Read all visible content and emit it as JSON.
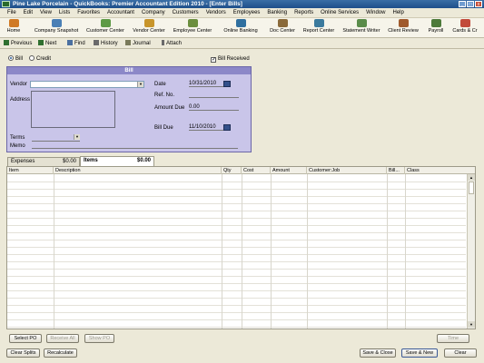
{
  "window": {
    "title": "Pine Lake Porcelain  - QuickBooks: Premier Accountant Edition 2010 - [Enter Bills]",
    "min": "_",
    "max": "□",
    "close": "x"
  },
  "menu": [
    "File",
    "Edit",
    "View",
    "Lists",
    "Favorites",
    "Accountant",
    "Company",
    "Customers",
    "Vendors",
    "Employees",
    "Banking",
    "Reports",
    "Online Services",
    "Window",
    "Help"
  ],
  "iconbar": [
    {
      "label": "Home",
      "icon": "home-icon",
      "color": "#d07a25"
    },
    {
      "label": "Company Snapshot",
      "icon": "snapshot-icon",
      "color": "#4a7fb5"
    },
    {
      "label": "Customer Center",
      "icon": "customer-icon",
      "color": "#5e9a45"
    },
    {
      "label": "Vendor Center",
      "icon": "vendor-icon",
      "color": "#c8952b"
    },
    {
      "label": "Employee Center",
      "icon": "employee-icon",
      "color": "#6b8e3e"
    },
    {
      "label": "Online Banking",
      "icon": "banking-icon",
      "color": "#2f6f9f"
    },
    {
      "label": "Doc Center",
      "icon": "doc-icon",
      "color": "#8a6a3a"
    },
    {
      "label": "Report Center",
      "icon": "report-icon",
      "color": "#3b7a9d"
    },
    {
      "label": "Statement Writer",
      "icon": "statement-icon",
      "color": "#5a8c4a"
    },
    {
      "label": "Client Review",
      "icon": "review-icon",
      "color": "#a05a2c"
    },
    {
      "label": "Payroll",
      "icon": "payroll-icon",
      "color": "#4d7a3a"
    },
    {
      "label": "Cards & Cr",
      "icon": "cards-icon",
      "color": "#c24a3a"
    }
  ],
  "formbar": {
    "previous": "Previous",
    "next": "Next",
    "find": "Find",
    "history": "History",
    "journal": "Journal",
    "attach": "Attach"
  },
  "options": {
    "bill": "Bill",
    "credit": "Credit",
    "bill_received": "Bill Received",
    "bill_received_checked": "✓"
  },
  "bill": {
    "header": "Bill",
    "vendor_label": "Vendor",
    "vendor_value": "",
    "address_label": "Address",
    "terms_label": "Terms",
    "memo_label": "Memo",
    "date_label": "Date",
    "date_value": "10/31/2010",
    "refno_label": "Ref. No.",
    "amount_due_label": "Amount Due",
    "amount_due_value": "0.00",
    "bill_due_label": "Bill Due",
    "bill_due_value": "11/10/2010"
  },
  "tabs": {
    "expenses": "Expenses",
    "expenses_amount": "$0.00",
    "items": "Items",
    "items_amount": "$0.00"
  },
  "grid": {
    "columns": [
      "Item",
      "Description",
      "Qty",
      "Cost",
      "Amount",
      "Customer:Job",
      "Bill...",
      "Class"
    ]
  },
  "grid_buttons": {
    "select_po": "Select PO",
    "receive_all": "Receive All",
    "show_po": "Show PO",
    "time": "Time"
  },
  "footer": {
    "clear_splits": "Clear Splits",
    "recalculate": "Recalculate",
    "save_close": "Save & Close",
    "save_new": "Save & New",
    "clear": "Clear"
  }
}
